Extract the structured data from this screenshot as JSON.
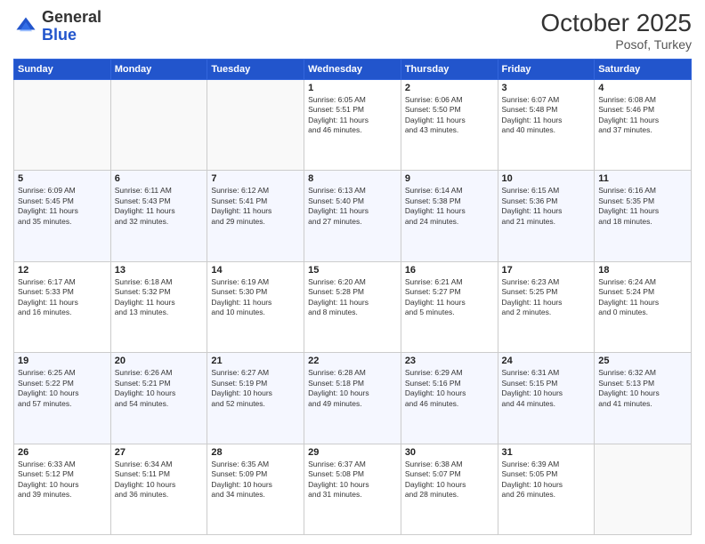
{
  "header": {
    "logo": {
      "general": "General",
      "blue": "Blue"
    },
    "month_year": "October 2025",
    "location": "Posof, Turkey"
  },
  "calendar": {
    "days_of_week": [
      "Sunday",
      "Monday",
      "Tuesday",
      "Wednesday",
      "Thursday",
      "Friday",
      "Saturday"
    ],
    "weeks": [
      [
        {
          "day": "",
          "empty": true
        },
        {
          "day": "",
          "empty": true
        },
        {
          "day": "",
          "empty": true
        },
        {
          "day": "1",
          "lines": [
            "Sunrise: 6:05 AM",
            "Sunset: 5:51 PM",
            "Daylight: 11 hours",
            "and 46 minutes."
          ]
        },
        {
          "day": "2",
          "lines": [
            "Sunrise: 6:06 AM",
            "Sunset: 5:50 PM",
            "Daylight: 11 hours",
            "and 43 minutes."
          ]
        },
        {
          "day": "3",
          "lines": [
            "Sunrise: 6:07 AM",
            "Sunset: 5:48 PM",
            "Daylight: 11 hours",
            "and 40 minutes."
          ]
        },
        {
          "day": "4",
          "lines": [
            "Sunrise: 6:08 AM",
            "Sunset: 5:46 PM",
            "Daylight: 11 hours",
            "and 37 minutes."
          ]
        }
      ],
      [
        {
          "day": "5",
          "lines": [
            "Sunrise: 6:09 AM",
            "Sunset: 5:45 PM",
            "Daylight: 11 hours",
            "and 35 minutes."
          ]
        },
        {
          "day": "6",
          "lines": [
            "Sunrise: 6:11 AM",
            "Sunset: 5:43 PM",
            "Daylight: 11 hours",
            "and 32 minutes."
          ]
        },
        {
          "day": "7",
          "lines": [
            "Sunrise: 6:12 AM",
            "Sunset: 5:41 PM",
            "Daylight: 11 hours",
            "and 29 minutes."
          ]
        },
        {
          "day": "8",
          "lines": [
            "Sunrise: 6:13 AM",
            "Sunset: 5:40 PM",
            "Daylight: 11 hours",
            "and 27 minutes."
          ]
        },
        {
          "day": "9",
          "lines": [
            "Sunrise: 6:14 AM",
            "Sunset: 5:38 PM",
            "Daylight: 11 hours",
            "and 24 minutes."
          ]
        },
        {
          "day": "10",
          "lines": [
            "Sunrise: 6:15 AM",
            "Sunset: 5:36 PM",
            "Daylight: 11 hours",
            "and 21 minutes."
          ]
        },
        {
          "day": "11",
          "lines": [
            "Sunrise: 6:16 AM",
            "Sunset: 5:35 PM",
            "Daylight: 11 hours",
            "and 18 minutes."
          ]
        }
      ],
      [
        {
          "day": "12",
          "lines": [
            "Sunrise: 6:17 AM",
            "Sunset: 5:33 PM",
            "Daylight: 11 hours",
            "and 16 minutes."
          ]
        },
        {
          "day": "13",
          "lines": [
            "Sunrise: 6:18 AM",
            "Sunset: 5:32 PM",
            "Daylight: 11 hours",
            "and 13 minutes."
          ]
        },
        {
          "day": "14",
          "lines": [
            "Sunrise: 6:19 AM",
            "Sunset: 5:30 PM",
            "Daylight: 11 hours",
            "and 10 minutes."
          ]
        },
        {
          "day": "15",
          "lines": [
            "Sunrise: 6:20 AM",
            "Sunset: 5:28 PM",
            "Daylight: 11 hours",
            "and 8 minutes."
          ]
        },
        {
          "day": "16",
          "lines": [
            "Sunrise: 6:21 AM",
            "Sunset: 5:27 PM",
            "Daylight: 11 hours",
            "and 5 minutes."
          ]
        },
        {
          "day": "17",
          "lines": [
            "Sunrise: 6:23 AM",
            "Sunset: 5:25 PM",
            "Daylight: 11 hours",
            "and 2 minutes."
          ]
        },
        {
          "day": "18",
          "lines": [
            "Sunrise: 6:24 AM",
            "Sunset: 5:24 PM",
            "Daylight: 11 hours",
            "and 0 minutes."
          ]
        }
      ],
      [
        {
          "day": "19",
          "lines": [
            "Sunrise: 6:25 AM",
            "Sunset: 5:22 PM",
            "Daylight: 10 hours",
            "and 57 minutes."
          ]
        },
        {
          "day": "20",
          "lines": [
            "Sunrise: 6:26 AM",
            "Sunset: 5:21 PM",
            "Daylight: 10 hours",
            "and 54 minutes."
          ]
        },
        {
          "day": "21",
          "lines": [
            "Sunrise: 6:27 AM",
            "Sunset: 5:19 PM",
            "Daylight: 10 hours",
            "and 52 minutes."
          ]
        },
        {
          "day": "22",
          "lines": [
            "Sunrise: 6:28 AM",
            "Sunset: 5:18 PM",
            "Daylight: 10 hours",
            "and 49 minutes."
          ]
        },
        {
          "day": "23",
          "lines": [
            "Sunrise: 6:29 AM",
            "Sunset: 5:16 PM",
            "Daylight: 10 hours",
            "and 46 minutes."
          ]
        },
        {
          "day": "24",
          "lines": [
            "Sunrise: 6:31 AM",
            "Sunset: 5:15 PM",
            "Daylight: 10 hours",
            "and 44 minutes."
          ]
        },
        {
          "day": "25",
          "lines": [
            "Sunrise: 6:32 AM",
            "Sunset: 5:13 PM",
            "Daylight: 10 hours",
            "and 41 minutes."
          ]
        }
      ],
      [
        {
          "day": "26",
          "lines": [
            "Sunrise: 6:33 AM",
            "Sunset: 5:12 PM",
            "Daylight: 10 hours",
            "and 39 minutes."
          ]
        },
        {
          "day": "27",
          "lines": [
            "Sunrise: 6:34 AM",
            "Sunset: 5:11 PM",
            "Daylight: 10 hours",
            "and 36 minutes."
          ]
        },
        {
          "day": "28",
          "lines": [
            "Sunrise: 6:35 AM",
            "Sunset: 5:09 PM",
            "Daylight: 10 hours",
            "and 34 minutes."
          ]
        },
        {
          "day": "29",
          "lines": [
            "Sunrise: 6:37 AM",
            "Sunset: 5:08 PM",
            "Daylight: 10 hours",
            "and 31 minutes."
          ]
        },
        {
          "day": "30",
          "lines": [
            "Sunrise: 6:38 AM",
            "Sunset: 5:07 PM",
            "Daylight: 10 hours",
            "and 28 minutes."
          ]
        },
        {
          "day": "31",
          "lines": [
            "Sunrise: 6:39 AM",
            "Sunset: 5:05 PM",
            "Daylight: 10 hours",
            "and 26 minutes."
          ]
        },
        {
          "day": "",
          "empty": true
        }
      ]
    ]
  }
}
